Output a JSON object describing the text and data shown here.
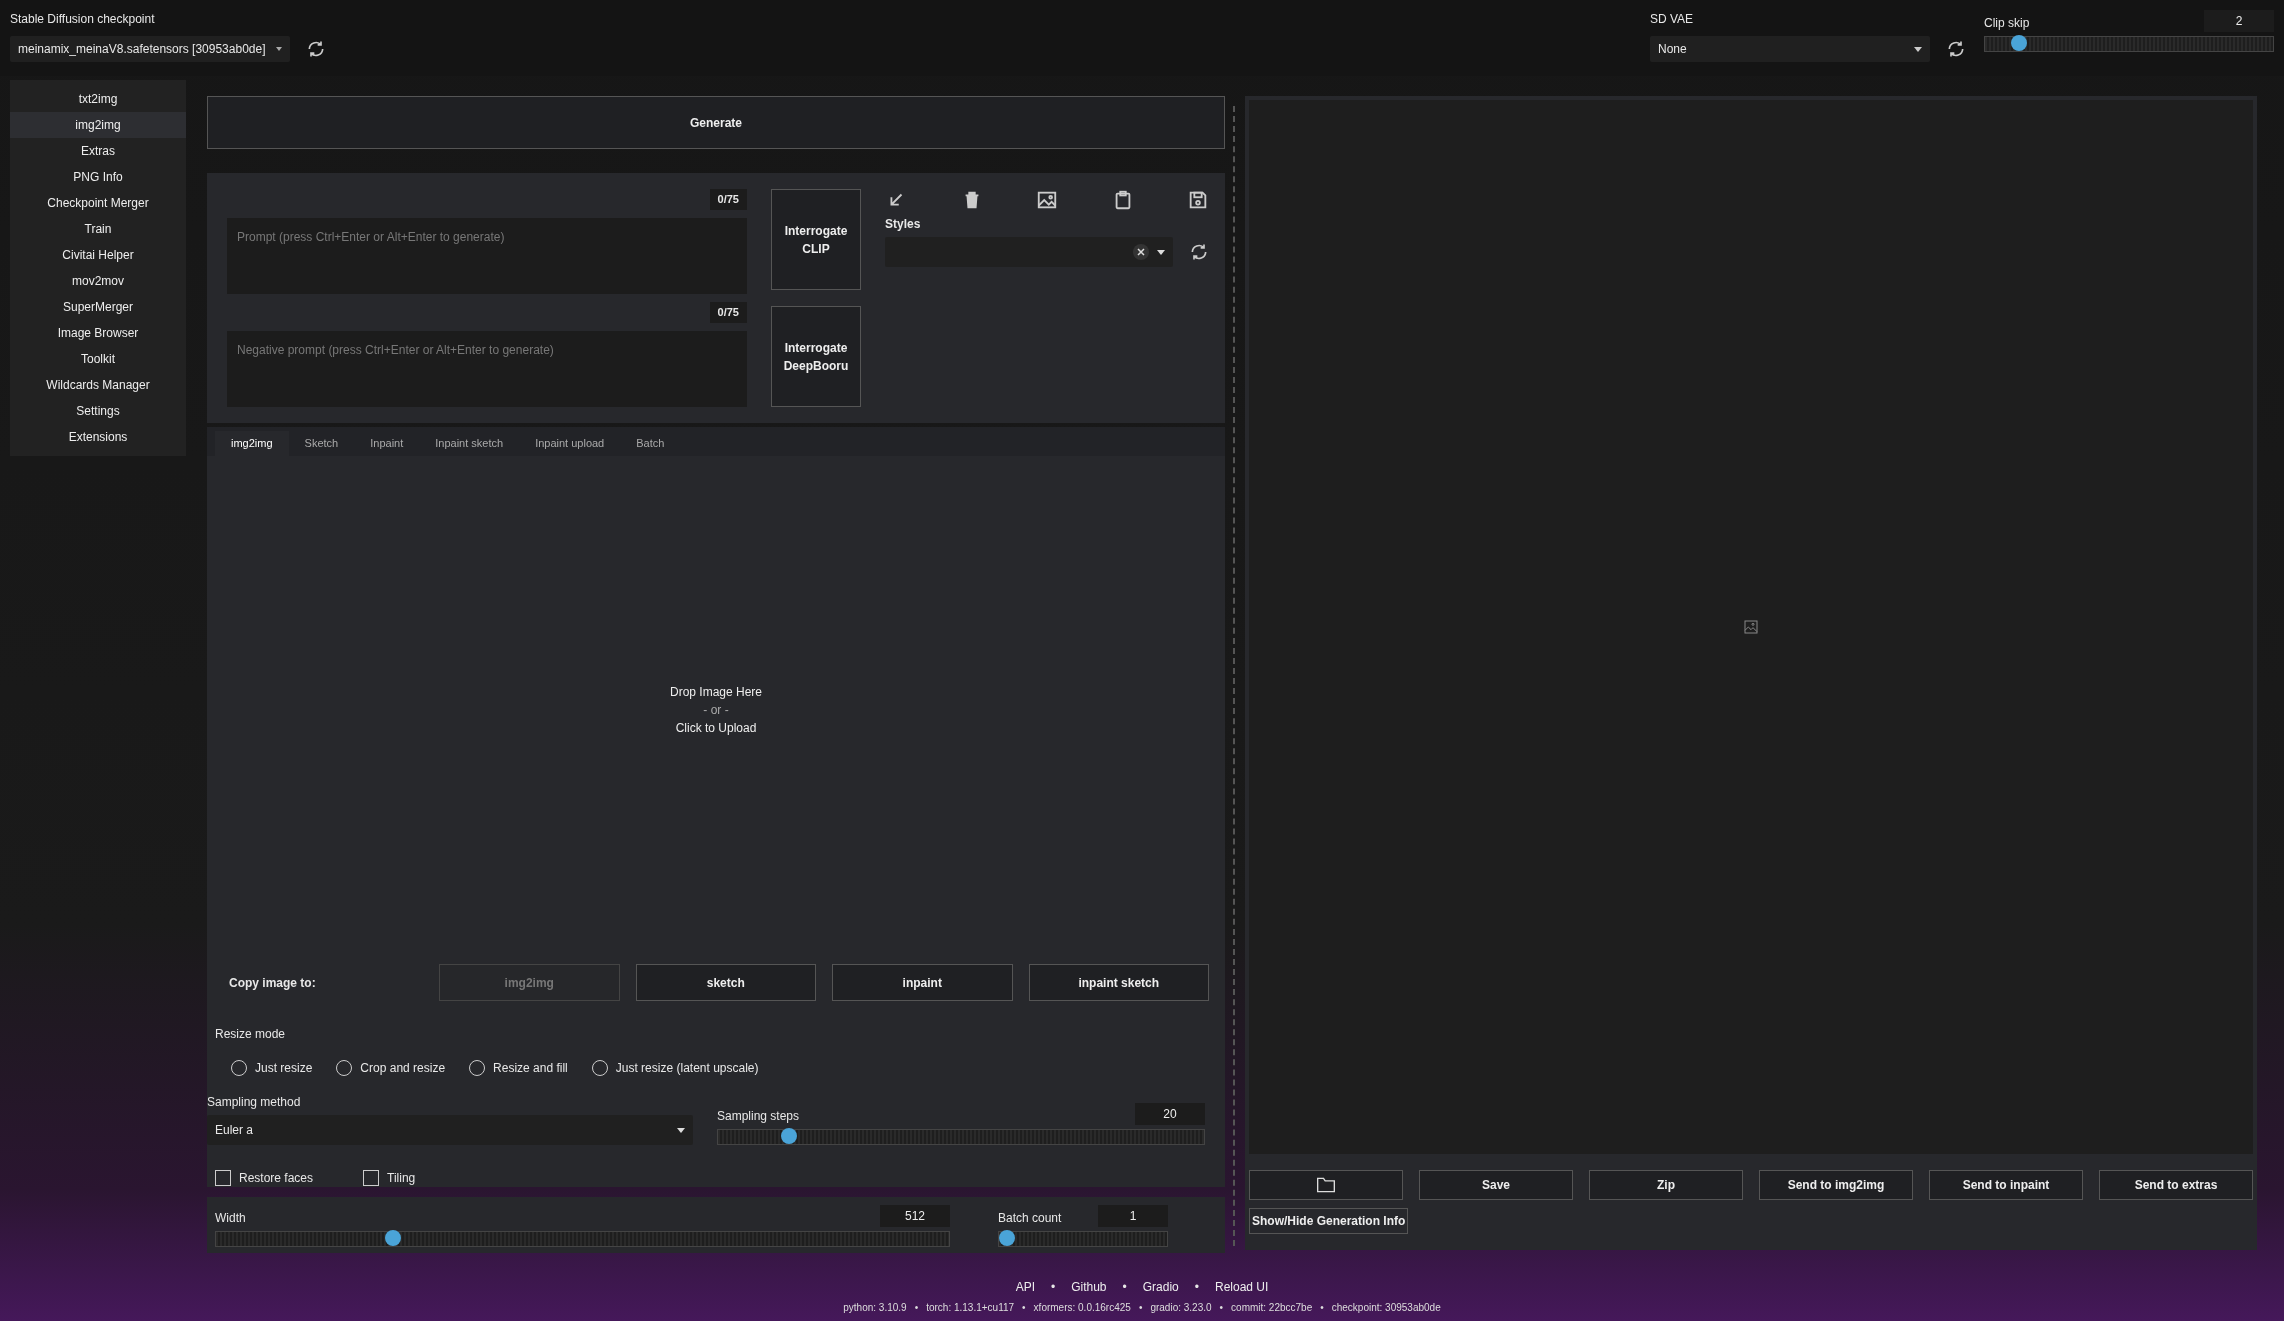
{
  "checkpoint": {
    "label": "Stable Diffusion checkpoint",
    "value": "meinamix_meinaV8.safetensors [30953ab0de]"
  },
  "vae": {
    "label": "SD VAE",
    "value": "None"
  },
  "clip_skip": {
    "label": "Clip skip",
    "value": "2",
    "level": 0.09
  },
  "sidebar": {
    "items": [
      {
        "label": "txt2img",
        "selected": false
      },
      {
        "label": "img2img",
        "selected": true
      },
      {
        "label": "Extras",
        "selected": false
      },
      {
        "label": "PNG Info",
        "selected": false
      },
      {
        "label": "Checkpoint Merger",
        "selected": false
      },
      {
        "label": "Train",
        "selected": false
      },
      {
        "label": "Civitai Helper",
        "selected": false
      },
      {
        "label": "mov2mov",
        "selected": false
      },
      {
        "label": "SuperMerger",
        "selected": false
      },
      {
        "label": "Image Browser",
        "selected": false
      },
      {
        "label": "Toolkit",
        "selected": false
      },
      {
        "label": "Wildcards Manager",
        "selected": false
      },
      {
        "label": "Settings",
        "selected": false
      },
      {
        "label": "Extensions",
        "selected": false
      }
    ]
  },
  "generate_button": "Generate",
  "prompt": {
    "placeholder": "Prompt (press Ctrl+Enter or Alt+Enter to generate)",
    "counter": "0/75"
  },
  "negative_prompt": {
    "placeholder": "Negative prompt (press Ctrl+Enter or Alt+Enter to generate)",
    "counter": "0/75"
  },
  "interrogate_buttons": [
    "Interrogate CLIP",
    "Interrogate DeepBooru"
  ],
  "styles": {
    "label": "Styles"
  },
  "tabs": [
    {
      "label": "img2img",
      "selected": true
    },
    {
      "label": "Sketch",
      "selected": false
    },
    {
      "label": "Inpaint",
      "selected": false
    },
    {
      "label": "Inpaint sketch",
      "selected": false
    },
    {
      "label": "Inpaint upload",
      "selected": false
    },
    {
      "label": "Batch",
      "selected": false
    }
  ],
  "drop_zone": {
    "lines": [
      "Drop Image Here",
      "- or -",
      "Click to Upload"
    ]
  },
  "copy_image": {
    "label": "Copy image to:",
    "buttons": [
      {
        "label": "img2img",
        "disabled": true
      },
      {
        "label": "sketch",
        "disabled": false
      },
      {
        "label": "inpaint",
        "disabled": false
      },
      {
        "label": "inpaint sketch",
        "disabled": false
      }
    ]
  },
  "resize_mode": {
    "label": "Resize mode",
    "options": [
      {
        "label": "Just resize",
        "selected": false
      },
      {
        "label": "Crop and resize",
        "selected": false
      },
      {
        "label": "Resize and fill",
        "selected": false
      },
      {
        "label": "Just resize (latent upscale)",
        "selected": false
      }
    ]
  },
  "sampling_method": {
    "label": "Sampling method",
    "value": "Euler a"
  },
  "sampling_steps": {
    "label": "Sampling steps",
    "value": "20",
    "level": 0.13
  },
  "checkboxes": [
    {
      "label": "Restore faces",
      "checked": false
    },
    {
      "label": "Tiling",
      "checked": false
    }
  ],
  "width": {
    "label": "Width",
    "value": "512",
    "level": 0.23
  },
  "batch_count": {
    "label": "Batch count",
    "value": "1",
    "level": 0
  },
  "output": {
    "buttons": [
      {
        "kind": "icon"
      },
      {
        "kind": "text",
        "label": "Save"
      },
      {
        "kind": "text",
        "label": "Zip"
      },
      {
        "kind": "text",
        "label": "Send to img2img"
      },
      {
        "kind": "text",
        "label": "Send to inpaint"
      },
      {
        "kind": "text",
        "label": "Send to extras"
      }
    ],
    "info_button": "Show/Hide Generation Info"
  },
  "footer": {
    "separator": "•",
    "links": [
      "API",
      "Github",
      "Gradio",
      "Reload UI"
    ],
    "versions": [
      "python: 3.10.9",
      "torch: 1.13.1+cu117",
      "xformers: 0.0.16rc425",
      "gradio: 3.23.0",
      "commit: 22bcc7be",
      "checkpoint: 30953ab0de"
    ]
  }
}
